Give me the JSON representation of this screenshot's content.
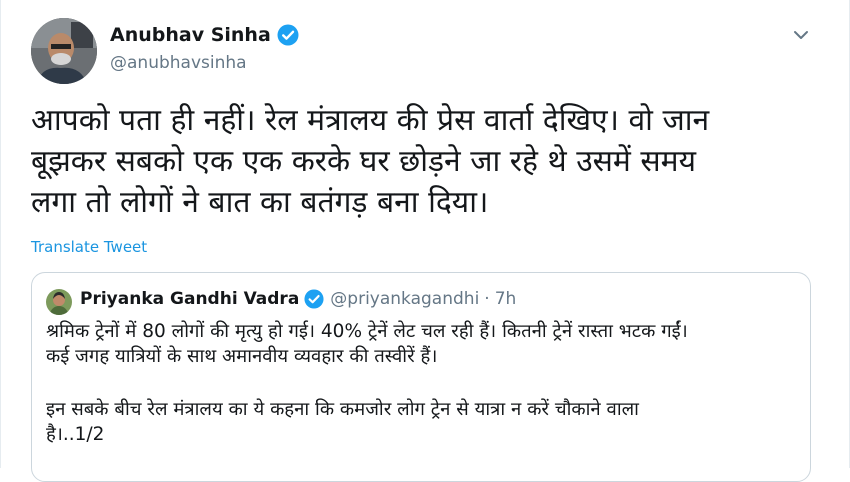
{
  "author": {
    "name": "Anubhav Sinha",
    "handle": "@anubhavsinha"
  },
  "tweet": {
    "lines": [
      "आपको पता ही नहीं। रेल मंत्रालय की प्रेस वार्ता देखिए। वो जान",
      "बूझकर सबको एक एक करके घर छोड़ने जा रहे थे उसमें समय",
      "लगा तो लोगों ने बात का बतंगड़ बना दिया।"
    ],
    "translate_label": "Translate Tweet"
  },
  "quoted": {
    "name": "Priyanka Gandhi Vadra",
    "handle": "@priyankagandhi",
    "separator": "·",
    "time": "7h",
    "paragraph1": [
      "श्रमिक ट्रेनों में 80 लोगों की मृत्यु हो गई। 40% ट्रेनें लेट चल रही हैं। कितनी ट्रेनें रास्ता भटक गईं।",
      "कई जगह यात्रियों के साथ अमानवीय व्यवहार की तस्वीरें हैं।"
    ],
    "paragraph2": [
      "इन सबके बीच रेल मंत्रालय का ये कहना कि कमजोर लोग ट्रेन से यात्रा न करें चौकाने वाला",
      "है।..1/2"
    ]
  },
  "icons": {
    "verified": "verified-badge-icon",
    "caret": "chevron-down-icon"
  },
  "colors": {
    "verified_blue": "#1da1f2",
    "link_blue": "#1b95e0",
    "secondary_text": "#657786"
  }
}
